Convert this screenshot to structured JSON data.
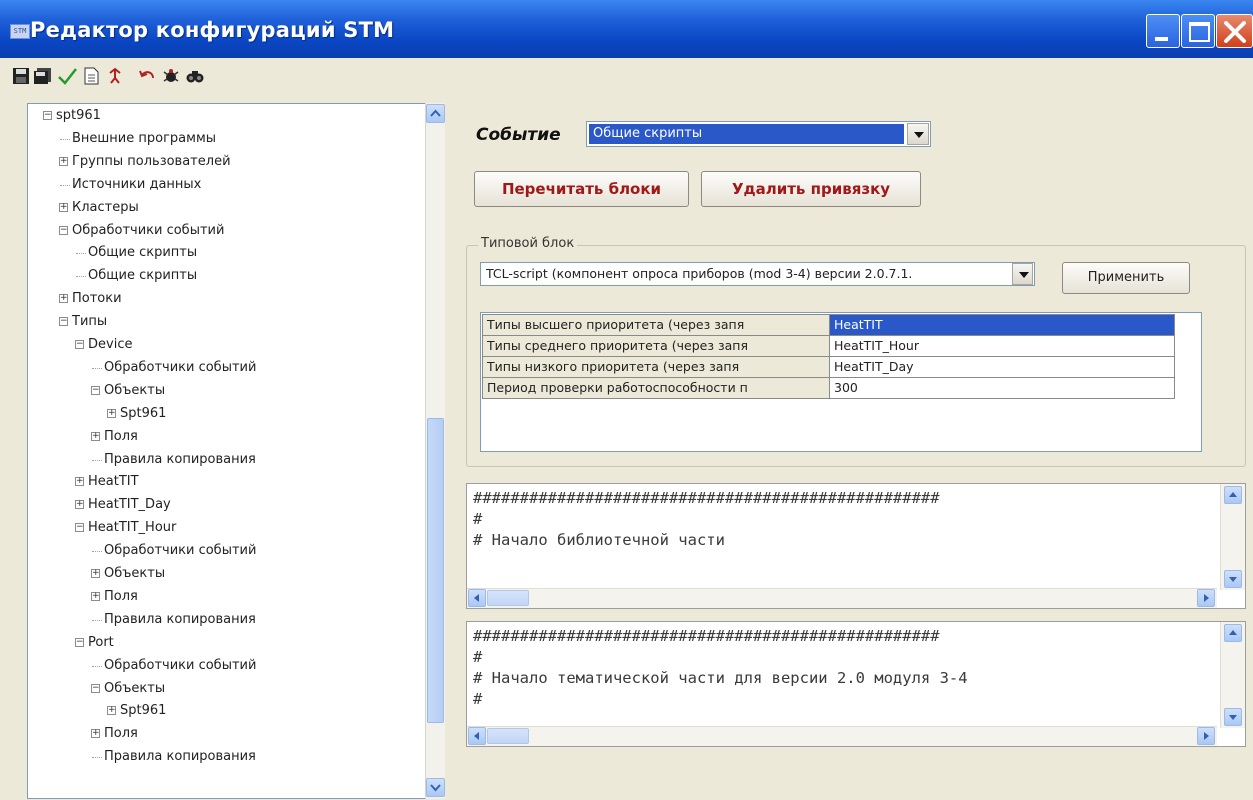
{
  "window": {
    "app_icon_text": "STM",
    "title": "Редактор конфигураций STM"
  },
  "toolbar": {
    "icons": [
      "save-icon",
      "save-all-icon",
      "check-icon",
      "document-icon",
      "run-icon",
      "undo-icon",
      "bug-icon",
      "find-icon"
    ]
  },
  "tree": {
    "items": [
      {
        "label": "spt961",
        "expander": "−"
      },
      {
        "label": "Внешние программы",
        "expander": ""
      },
      {
        "label": "Группы пользователей",
        "expander": "+"
      },
      {
        "label": "Источники данных",
        "expander": ""
      },
      {
        "label": "Кластеры",
        "expander": "+"
      },
      {
        "label": "Обработчики событий",
        "expander": "−"
      },
      {
        "label": "Общие скрипты",
        "expander": ""
      },
      {
        "label": "Общие скрипты",
        "expander": ""
      },
      {
        "label": "Потоки",
        "expander": "+"
      },
      {
        "label": "Типы",
        "expander": "−"
      },
      {
        "label": "Device",
        "expander": "−"
      },
      {
        "label": "Обработчики событий",
        "expander": ""
      },
      {
        "label": "Объекты",
        "expander": "−"
      },
      {
        "label": "Spt961",
        "expander": "+"
      },
      {
        "label": "Поля",
        "expander": "+"
      },
      {
        "label": "Правила копирования",
        "expander": ""
      },
      {
        "label": "HeatTIT",
        "expander": "+"
      },
      {
        "label": "HeatTIT_Day",
        "expander": "+"
      },
      {
        "label": "HeatTIT_Hour",
        "expander": "−"
      },
      {
        "label": "Обработчики событий",
        "expander": ""
      },
      {
        "label": "Объекты",
        "expander": "+"
      },
      {
        "label": "Поля",
        "expander": "+"
      },
      {
        "label": "Правила копирования",
        "expander": ""
      },
      {
        "label": "Port",
        "expander": "−"
      },
      {
        "label": "Обработчики событий",
        "expander": ""
      },
      {
        "label": "Объекты",
        "expander": "−"
      },
      {
        "label": "Spt961",
        "expander": "+"
      },
      {
        "label": "Поля",
        "expander": "+"
      },
      {
        "label": "Правила копирования",
        "expander": ""
      }
    ]
  },
  "event": {
    "label": "Событие",
    "selected": "Общие скрипты"
  },
  "buttons": {
    "reread": "Перечитать блоки",
    "unlink": "Удалить привязку",
    "apply": "Применить"
  },
  "typical_block": {
    "title": "Типовой блок",
    "selected": "TCL-script (компонент опроса приборов (mod 3-4) версии 2.0.7.1."
  },
  "properties": [
    {
      "name": "Типы высшего приоритета (через запя",
      "value": "HeatTIT",
      "selected": true
    },
    {
      "name": "Типы среднего приоритета (через запя",
      "value": "HeatTIT_Hour",
      "selected": false
    },
    {
      "name": "Типы низкого приоритета (через запя",
      "value": "HeatTIT_Day",
      "selected": false
    },
    {
      "name": "Период проверки работоспособности п",
      "value": "300",
      "selected": false
    }
  ],
  "editors": [
    {
      "lines": [
        "##################################################",
        "#",
        "# Начало библиотечной части"
      ]
    },
    {
      "lines": [
        "##################################################",
        "#",
        "# Начало тематической части для версии 2.0 модуля 3-4",
        "#"
      ]
    }
  ]
}
